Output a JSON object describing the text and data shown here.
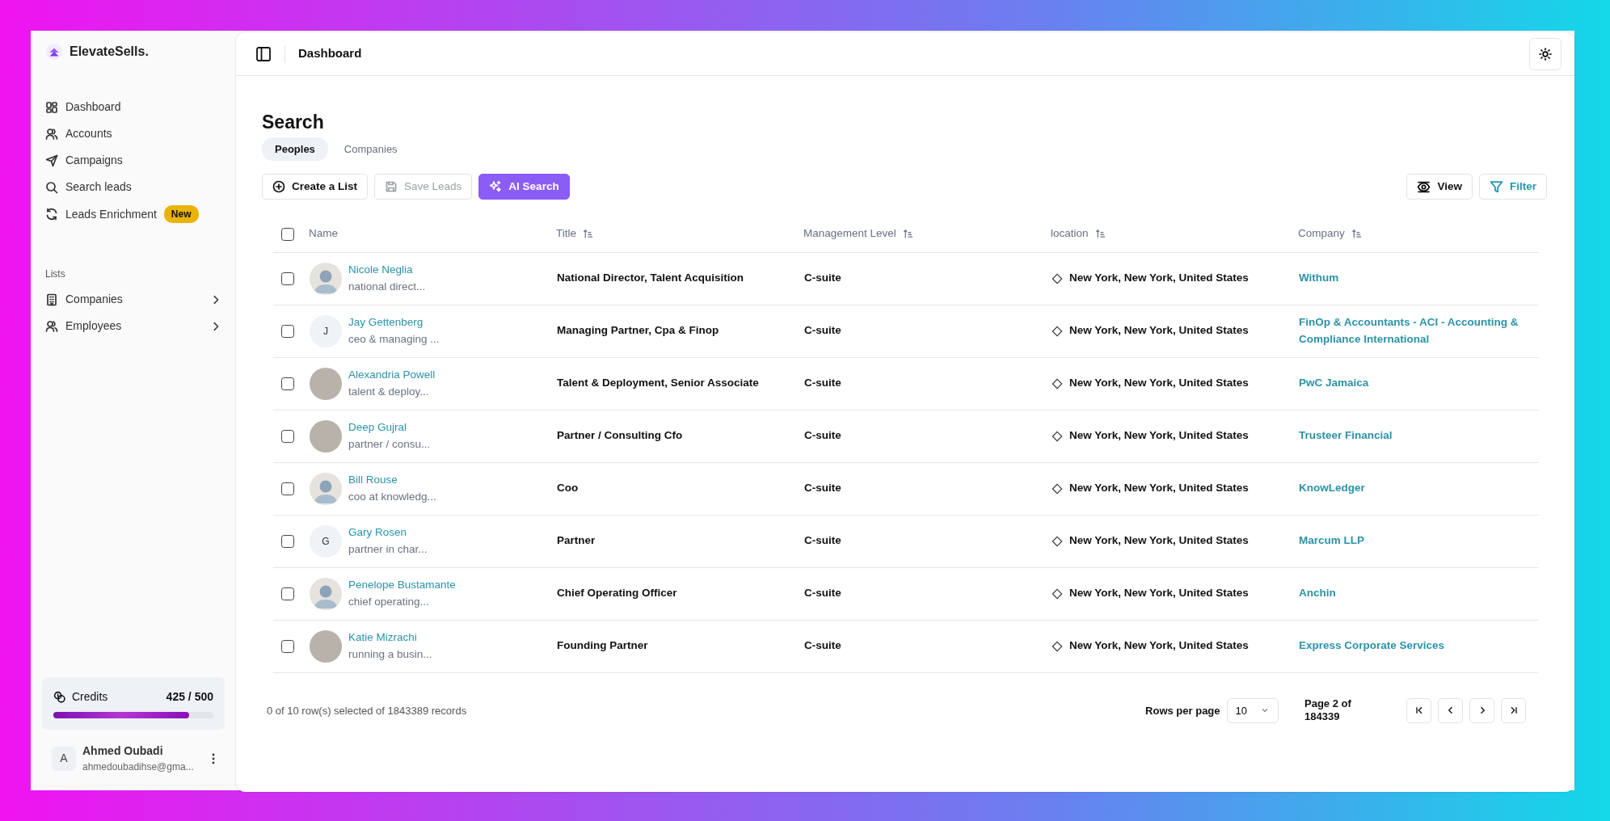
{
  "sidebar": {
    "brand": "ElevateSells.",
    "nav": [
      {
        "label": "Dashboard"
      },
      {
        "label": "Accounts"
      },
      {
        "label": "Campaigns"
      },
      {
        "label": "Search leads"
      },
      {
        "label": "Leads Enrichment",
        "badge": "New"
      }
    ],
    "lists_heading": "Lists",
    "lists": [
      {
        "label": "Companies"
      },
      {
        "label": "Employees"
      }
    ],
    "credits": {
      "label": "Credits",
      "reading": "425 / 500",
      "level": 0.85
    },
    "user": {
      "initial": "A",
      "name": "Ahmed Oubadi",
      "email": "ahmedoubadihse@gma..."
    }
  },
  "header": {
    "title": "Dashboard"
  },
  "page": {
    "title": "Search",
    "tabs": [
      {
        "label": "Peoples",
        "selected": true
      },
      {
        "label": "Companies",
        "selected": false
      }
    ],
    "actions": [
      {
        "label": "Create a List",
        "kind": "outline",
        "disabled": false
      },
      {
        "label": "Save Leads",
        "kind": "outline",
        "disabled": true
      },
      {
        "label": "AI Search",
        "kind": "primary",
        "disabled": false
      }
    ],
    "right_actions": [
      {
        "label": "View",
        "kind": "dark"
      },
      {
        "label": "Filter",
        "kind": "accent"
      }
    ]
  },
  "table": {
    "select_all_checked": false,
    "columns": [
      {
        "label": "Name",
        "sortable": false
      },
      {
        "label": "Title",
        "sortable": true
      },
      {
        "label": "Management Level",
        "sortable": true
      },
      {
        "label": "location",
        "sortable": true
      },
      {
        "label": "Company",
        "sortable": true
      }
    ],
    "rows": [
      {
        "checked": false,
        "kind": "silhouette",
        "name": "Nicole Neglia",
        "subtitle": "national direct...",
        "title": "National Director, Talent Acquisition",
        "level": "C-suite",
        "location": "New York, New York, United States",
        "company": "Withum"
      },
      {
        "checked": false,
        "kind": "initial",
        "initial": "J",
        "name": "Jay Gettenberg",
        "subtitle": "ceo & managing ...",
        "title": "Managing Partner, Cpa & Finop",
        "level": "C-suite",
        "location": "New York, New York, United States",
        "company": "FinOp & Accountants - ACI - Accounting & Compliance International"
      },
      {
        "checked": false,
        "kind": "photo",
        "name": "Alexandria Powell",
        "subtitle": "talent & deploy...",
        "title": "Talent & Deployment, Senior Associate",
        "level": "C-suite",
        "location": "New York, New York, United States",
        "company": "PwC Jamaica"
      },
      {
        "checked": false,
        "kind": "photo",
        "name": "Deep Gujral",
        "subtitle": "partner / consu...",
        "title": "Partner / Consulting Cfo",
        "level": "C-suite",
        "location": "New York, New York, United States",
        "company": "Trusteer Financial"
      },
      {
        "checked": false,
        "kind": "silhouette",
        "name": "Bill Rouse",
        "subtitle": "coo at knowledg...",
        "title": "Coo",
        "level": "C-suite",
        "location": "New York, New York, United States",
        "company": "KnowLedger"
      },
      {
        "checked": false,
        "kind": "initial",
        "initial": "G",
        "name": "Gary Rosen",
        "subtitle": "partner in char...",
        "title": "Partner",
        "level": "C-suite",
        "location": "New York, New York, United States",
        "company": "Marcum LLP"
      },
      {
        "checked": false,
        "kind": "silhouette",
        "name": "Penelope Bustamante",
        "subtitle": "chief operating...",
        "title": "Chief Operating Officer",
        "level": "C-suite",
        "location": "New York, New York, United States",
        "company": "Anchin"
      },
      {
        "checked": false,
        "kind": "photo",
        "name": "Katie Mizrachi",
        "subtitle": "running a busin...",
        "title": "Founding Partner",
        "level": "C-suite",
        "location": "New York, New York, United States",
        "company": "Express Corporate Services"
      }
    ]
  },
  "footer": {
    "selection": "0 of 10 row(s) selected of 1843389 records",
    "rows_per_page_label": "Rows per page",
    "rows_per_page": "10",
    "page_info": "Page 2 of 184339"
  }
}
